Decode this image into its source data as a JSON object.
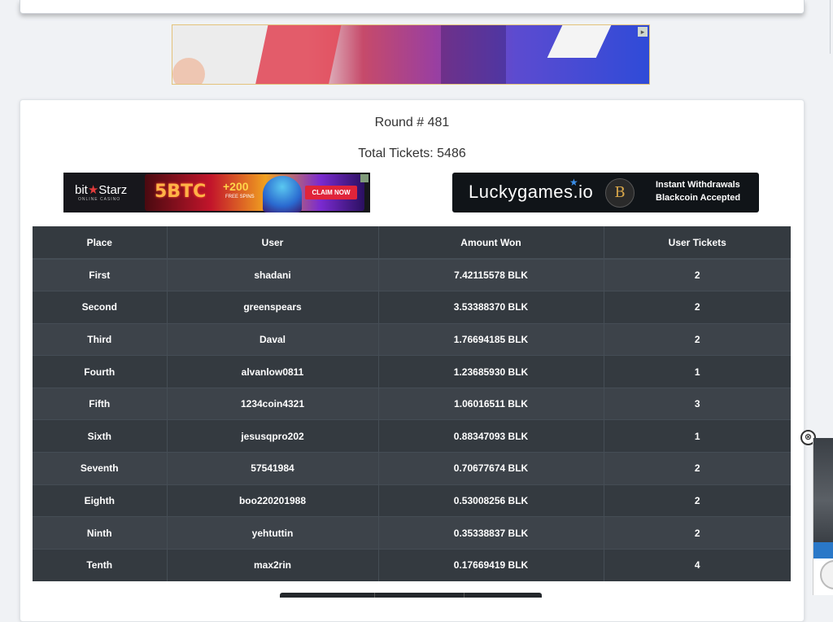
{
  "round": {
    "title": "Round # 481"
  },
  "total": {
    "label": "Total Tickets: 5486"
  },
  "ads": {
    "bitstarz": {
      "brand_a": "bit",
      "brand_b": "Starz",
      "sub": "ONLINE CASINO",
      "btc": "5BTC",
      "spins": "+200",
      "spins_sub": "FREE SPINS",
      "cta": "CLAIM NOW"
    },
    "lucky": {
      "logo": "Luckygames.io",
      "coin": "B",
      "line1": "Instant Withdrawals",
      "line2": "Blackcoin Accepted"
    }
  },
  "side_ad": {
    "close": "⊗"
  },
  "table": {
    "headers": [
      "Place",
      "User",
      "Amount Won",
      "User Tickets"
    ],
    "rows": [
      {
        "place": "First",
        "user": "shadani",
        "amount": "7.42115578 BLK",
        "tickets": "2"
      },
      {
        "place": "Second",
        "user": "greenspears",
        "amount": "3.53388370 BLK",
        "tickets": "2"
      },
      {
        "place": "Third",
        "user": "Daval",
        "amount": "1.76694185 BLK",
        "tickets": "2"
      },
      {
        "place": "Fourth",
        "user": "alvanlow0811",
        "amount": "1.23685930 BLK",
        "tickets": "1"
      },
      {
        "place": "Fifth",
        "user": "1234coin4321",
        "amount": "1.06016511 BLK",
        "tickets": "3"
      },
      {
        "place": "Sixth",
        "user": "jesusqpro202",
        "amount": "0.88347093 BLK",
        "tickets": "1"
      },
      {
        "place": "Seventh",
        "user": "57541984",
        "amount": "0.70677674 BLK",
        "tickets": "2"
      },
      {
        "place": "Eighth",
        "user": "boo220201988",
        "amount": "0.53008256 BLK",
        "tickets": "2"
      },
      {
        "place": "Ninth",
        "user": "yehtuttin",
        "amount": "0.35338837 BLK",
        "tickets": "2"
      },
      {
        "place": "Tenth",
        "user": "max2rin",
        "amount": "0.17669419 BLK",
        "tickets": "4"
      }
    ]
  }
}
